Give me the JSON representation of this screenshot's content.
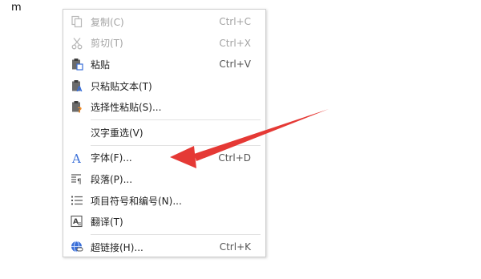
{
  "document": {
    "text": "m"
  },
  "context_menu": {
    "items": [
      {
        "label": "复制(C)",
        "shortcut": "Ctrl+C",
        "icon": "copy-icon",
        "disabled": true
      },
      {
        "label": "剪切(T)",
        "shortcut": "Ctrl+X",
        "icon": "scissors-icon",
        "disabled": true
      },
      {
        "label": "粘贴",
        "shortcut": "Ctrl+V",
        "icon": "clipboard-icon",
        "disabled": false
      },
      {
        "label": "只粘贴文本(T)",
        "shortcut": "",
        "icon": "paste-text-icon",
        "disabled": false
      },
      {
        "label": "选择性粘贴(S)...",
        "shortcut": "",
        "icon": "paste-special-icon",
        "disabled": false
      },
      {
        "label": "汉字重选(V)",
        "shortcut": "",
        "icon": "",
        "disabled": false
      },
      {
        "label": "字体(F)...",
        "shortcut": "Ctrl+D",
        "icon": "font-icon",
        "disabled": false
      },
      {
        "label": "段落(P)...",
        "shortcut": "",
        "icon": "paragraph-icon",
        "disabled": false
      },
      {
        "label": "项目符号和编号(N)...",
        "shortcut": "",
        "icon": "bullets-icon",
        "disabled": false
      },
      {
        "label": "翻译(T)",
        "shortcut": "",
        "icon": "translate-icon",
        "disabled": false
      },
      {
        "label": "超链接(H)...",
        "shortcut": "Ctrl+K",
        "icon": "hyperlink-icon",
        "disabled": false
      }
    ]
  },
  "colors": {
    "annotation_arrow": "#e53935",
    "icon_blue": "#3a6fd8",
    "icon_orange": "#f08a24"
  }
}
